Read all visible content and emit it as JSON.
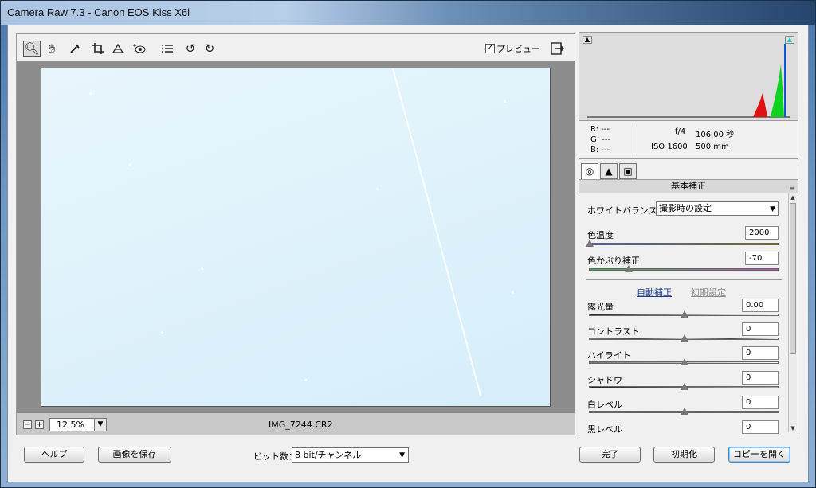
{
  "window": {
    "title": "Camera Raw 7.3  -  Canon EOS Kiss X6i"
  },
  "toolbar": {
    "tools": [
      "zoom-icon",
      "hand-icon",
      "white-balance-icon",
      "crop-icon",
      "straighten-icon",
      "red-eye-icon",
      "preferences-icon",
      "rotate-left-icon",
      "rotate-right-icon"
    ],
    "preview_label": "プレビュー",
    "preview_checked": true
  },
  "status": {
    "zoom": "12.5%",
    "filename": "IMG_7244.CR2"
  },
  "info": {
    "r": "R:  ---",
    "g": "G:  ---",
    "b": "B:  ---",
    "aperture": "f/4",
    "shutter": "106.00 秒",
    "iso": "ISO 1600",
    "focal": "500 mm"
  },
  "panel": {
    "title": "基本補正",
    "wb_label": "ホワイトバランス：",
    "wb_value": "撮影時の設定",
    "temp_label": "色温度",
    "temp_value": "2000",
    "tint_label": "色かぶり補正",
    "tint_value": "-70",
    "auto_link": "自動補正",
    "default_link": "初期設定",
    "sliders": [
      {
        "label": "露光量",
        "value": "0.00"
      },
      {
        "label": "コントラスト",
        "value": "0"
      },
      {
        "label": "ハイライト",
        "value": "0"
      },
      {
        "label": "シャドウ",
        "value": "0"
      },
      {
        "label": "白レベル",
        "value": "0"
      },
      {
        "label": "黒レベル",
        "value": "0"
      }
    ]
  },
  "bottom": {
    "help": "ヘルプ",
    "save": "画像を保存",
    "bit_label": "ビット数：",
    "bit_value": "8 bit/チャンネル",
    "done": "完了",
    "reset": "初期化",
    "open_copy": "コピーを開く"
  },
  "colors": {
    "photo": "#dff2fb",
    "hist_red": "#e01010",
    "hist_green": "#10d020",
    "link_blue": "#1a3b8f"
  }
}
